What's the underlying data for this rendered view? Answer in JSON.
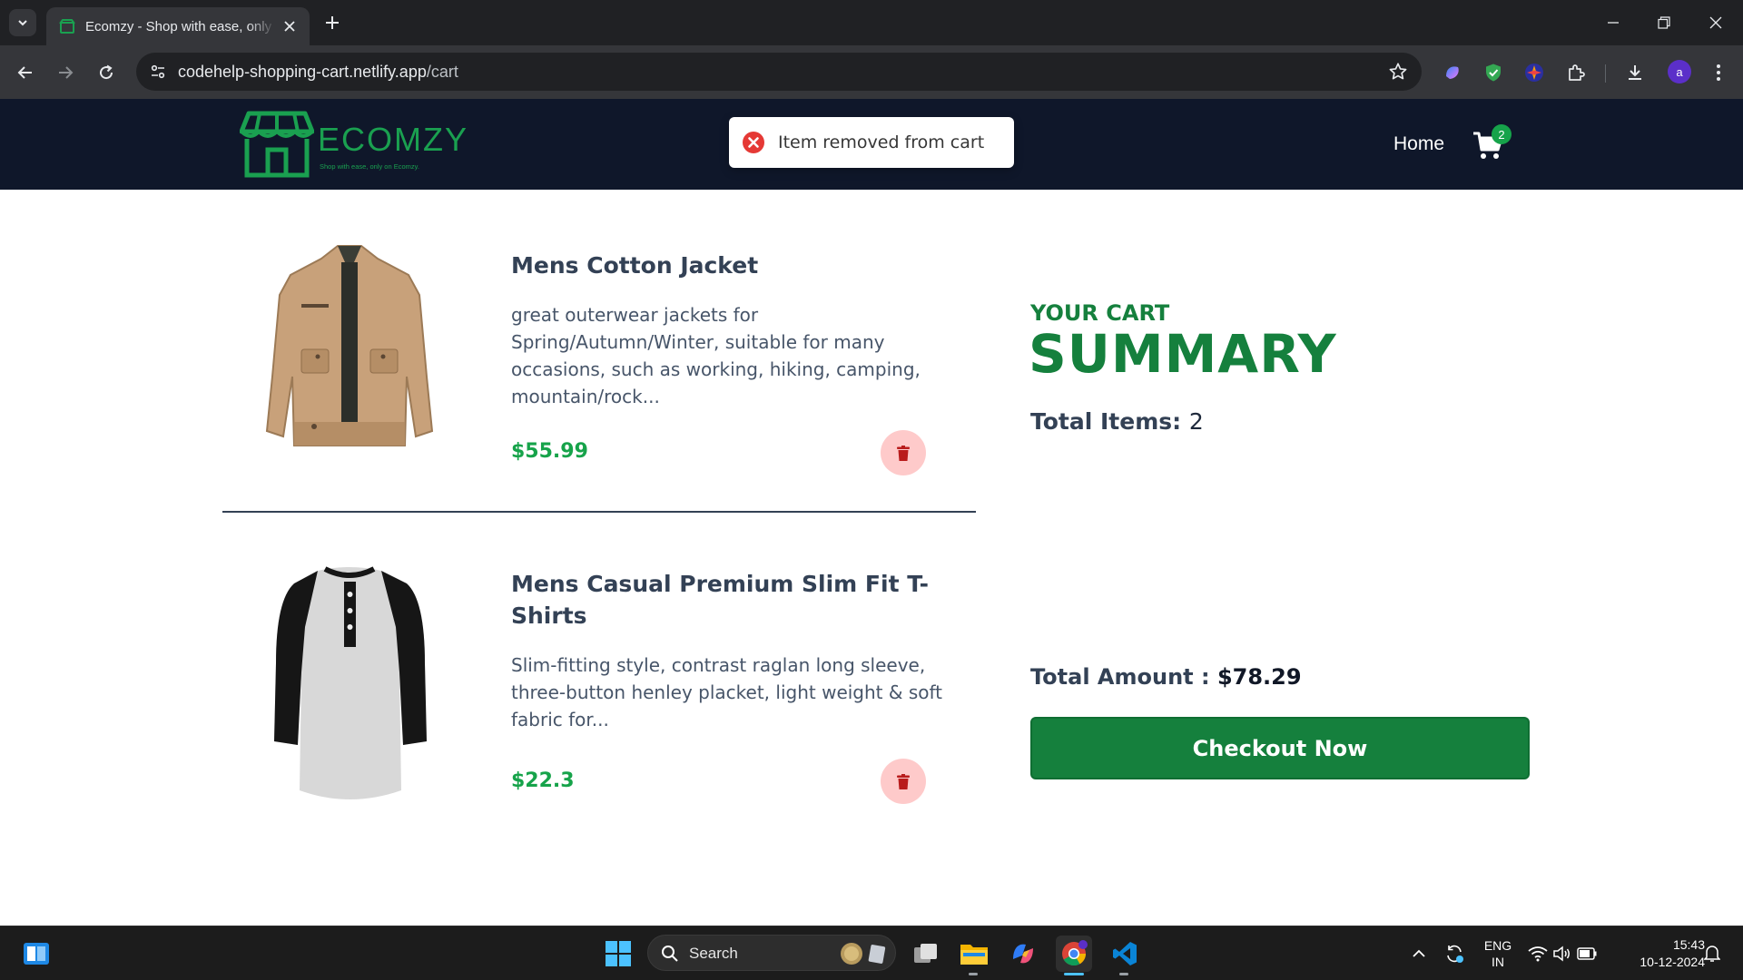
{
  "browser": {
    "tab_title": "Ecomzy - Shop with ease, only on Ecomzy",
    "url_host": "codehelp-shopping-cart.netlify.app",
    "url_path": "/cart",
    "profile_initial": "a",
    "icons": [
      "tab-search-icon",
      "close-icon",
      "new-tab-icon",
      "minimize-icon",
      "restore-icon",
      "back-icon",
      "forward-icon",
      "reload-icon",
      "site-info-icon",
      "bookmark-star-icon",
      "extensions-icon",
      "download-icon",
      "more-icon"
    ]
  },
  "header": {
    "logo_text": "ECOMZY",
    "logo_tagline": "Shop with ease, only on Ecomzy.",
    "nav_home": "Home",
    "cart_count": "2",
    "brand_color": "#1aa050",
    "bg_color": "#0f172a"
  },
  "toast": {
    "message": "Item removed from cart",
    "icon": "error-circle-icon"
  },
  "cart": {
    "items": [
      {
        "title": "Mens Cotton Jacket",
        "description": "great outerwear jackets for Spring/Autumn/Winter, suitable for many occasions, such as working, hiking, camping, mountain/rock...",
        "price": "$55.99",
        "image": "jacket-image"
      },
      {
        "title": "Mens Casual Premium Slim Fit T-Shirts",
        "description": "Slim-fitting style, contrast raglan long sleeve, three-button henley placket, light weight & soft fabric for...",
        "price": "$22.3",
        "image": "tshirt-image"
      }
    ]
  },
  "summary": {
    "label": "YOUR CART",
    "title": "SUMMARY",
    "total_items_label": "Total Items:",
    "total_items_value": "2",
    "total_amount_label": "Total Amount :",
    "total_amount_value": "$78.29",
    "checkout_label": "Checkout Now",
    "accent_color": "#15803d"
  },
  "taskbar": {
    "search_placeholder": "Search",
    "lang_line1": "ENG",
    "lang_line2": "IN",
    "time": "15:43",
    "date": "10-12-2024"
  }
}
